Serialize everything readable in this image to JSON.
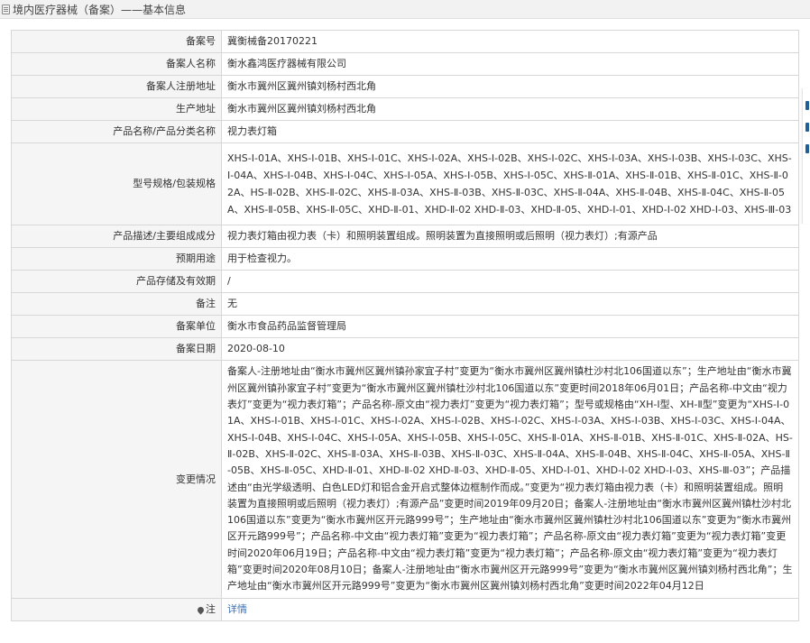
{
  "header": {
    "title": "境内医疗器械（备案）——基本信息"
  },
  "rows": {
    "record_no": {
      "label": "备案号",
      "value": "冀衡械备20170221"
    },
    "filer_name": {
      "label": "备案人名称",
      "value": "衡水鑫鸿医疗器械有限公司"
    },
    "filer_address": {
      "label": "备案人注册地址",
      "value": "衡水市冀州区冀州镇刘杨村西北角"
    },
    "production_address": {
      "label": "生产地址",
      "value": "衡水市冀州区冀州镇刘杨村西北角"
    },
    "product_name": {
      "label": "产品名称/产品分类名称",
      "value": "视力表灯箱"
    },
    "model_spec": {
      "label": "型号规格/包装规格",
      "value": "XHS-Ⅰ-01A、XHS-Ⅰ-01B、XHS-Ⅰ-01C、XHS-Ⅰ-02A、XHS-Ⅰ-02B、XHS-Ⅰ-02C、XHS-Ⅰ-03A、XHS-Ⅰ-03B、XHS-Ⅰ-03C、XHS-Ⅰ-04A、XHS-Ⅰ-04B、XHS-Ⅰ-04C、XHS-Ⅰ-05A、XHS-Ⅰ-05B、XHS-Ⅰ-05C、XHS-Ⅱ-01A、XHS-Ⅱ-01B、XHS-Ⅱ-01C、XHS-Ⅱ-02A、HS-Ⅱ-02B、XHS-Ⅱ-02C、XHS-Ⅱ-03A、XHS-Ⅱ-03B、XHS-Ⅱ-03C、XHS-Ⅱ-04A、XHS-Ⅱ-04B、XHS-Ⅱ-04C、XHS-Ⅱ-05A、XHS-Ⅱ-05B、XHS-Ⅱ-05C、XHD-Ⅱ-01、XHD-Ⅱ-02 XHD-Ⅱ-03、XHD-Ⅱ-05、XHD-Ⅰ-01、XHD-Ⅰ-02 XHD-Ⅰ-03、XHS-Ⅲ-03"
    },
    "description": {
      "label": "产品描述/主要组成成分",
      "value": "视力表灯箱由视力表（卡）和照明装置组成。照明装置为直接照明或后照明（视力表灯）;有源产品"
    },
    "intended_use": {
      "label": "预期用途",
      "value": "用于检查视力。"
    },
    "storage": {
      "label": "产品存储及有效期",
      "value": "/"
    },
    "remark": {
      "label": "备注",
      "value": "无"
    },
    "record_unit": {
      "label": "备案单位",
      "value": "衡水市食品药品监督管理局"
    },
    "record_date": {
      "label": "备案日期",
      "value": "2020-08-10"
    },
    "change": {
      "label": "变更情况",
      "value": "备案人-注册地址由“衡水市冀州区冀州镇孙家宜子村”变更为“衡水市冀州区冀州镇杜沙村北106国道以东”；生产地址由“衡水市冀州区冀州镇孙家宜子村”变更为“衡水市冀州区冀州镇杜沙村北106国道以东”变更时间2018年06月01日；产品名称-中文由“视力表灯”变更为“视力表灯箱”；产品名称-原文由“视力表灯”变更为“视力表灯箱”；型号或规格由“XH-Ⅰ型、XH-Ⅱ型”变更为“XHS-Ⅰ-01A、XHS-Ⅰ-01B、XHS-Ⅰ-01C、XHS-Ⅰ-02A、XHS-Ⅰ-02B、XHS-Ⅰ-02C、XHS-Ⅰ-03A、XHS-Ⅰ-03B、XHS-Ⅰ-03C、XHS-Ⅰ-04A、XHS-Ⅰ-04B、XHS-Ⅰ-04C、XHS-Ⅰ-05A、XHS-Ⅰ-05B、XHS-Ⅰ-05C、XHS-Ⅱ-01A、XHS-Ⅱ-01B、XHS-Ⅱ-01C、XHS-Ⅱ-02A、HS-Ⅱ-02B、XHS-Ⅱ-02C、XHS-Ⅱ-03A、XHS-Ⅱ-03B、XHS-Ⅱ-03C、XHS-Ⅱ-04A、XHS-Ⅱ-04B、XHS-Ⅱ-04C、XHS-Ⅱ-05A、XHS-Ⅱ-05B、XHS-Ⅱ-05C、XHD-Ⅱ-01、XHD-Ⅱ-02 XHD-Ⅱ-03、XHD-Ⅱ-05、XHD-Ⅰ-01、XHD-Ⅰ-02 XHD-Ⅰ-03、XHS-Ⅲ-03”；产品描述由“由光学级透明、白色LED灯和铝合金开启式整体边框制作而成。”变更为“视力表灯箱由视力表（卡）和照明装置组成。照明装置为直接照明或后照明（视力表灯）;有源产品”变更时间2019年09月20日；备案人-注册地址由“衡水市冀州区冀州镇杜沙村北106国道以东”变更为“衡水市冀州区开元路999号”；生产地址由“衡水市冀州区冀州镇杜沙村北106国道以东”变更为“衡水市冀州区开元路999号”；产品名称-中文由“视力表灯箱”变更为“视力表灯箱”；产品名称-原文由“视力表灯箱”变更为“视力表灯箱”变更时间2020年06月19日；产品名称-中文由“视力表灯箱”变更为“视力表灯箱”；产品名称-原文由“视力表灯箱”变更为“视力表灯箱”变更时间2020年08月10日；备案人-注册地址由“衡水市冀州区开元路999号”变更为“衡水市冀州区冀州镇刘杨村西北角”；生产地址由“衡水市冀州区开元路999号”变更为“衡水市冀州区冀州镇刘杨村西北角”变更时间2022年04月12日"
    },
    "note": {
      "label": "注",
      "value": "详情"
    }
  },
  "icons": {
    "header": "document-icon",
    "note": "pin-icon"
  },
  "colors": {
    "link": "#3a6fb5",
    "label_bg": "#f5f5f5",
    "border": "#d7d7d7"
  }
}
